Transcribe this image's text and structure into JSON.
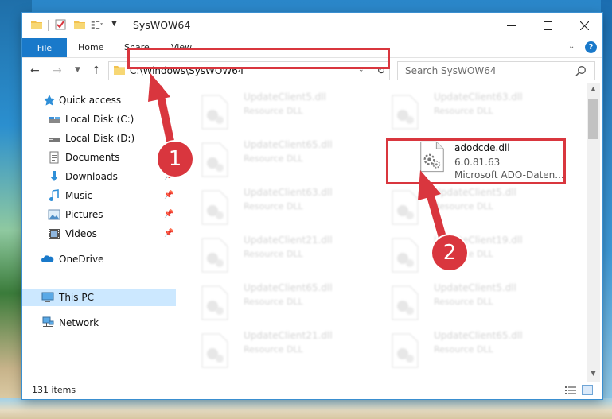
{
  "window": {
    "title": "SysWOW64"
  },
  "ribbon": {
    "file": "File",
    "home": "Home",
    "share": "Share",
    "view": "View",
    "help": "?"
  },
  "address": {
    "path": "C:\\Windows\\SysWOW64"
  },
  "search": {
    "placeholder": "Search SysWOW64"
  },
  "nav_pane": {
    "quick_access": "Quick access",
    "items": [
      {
        "label": "Local Disk (C:)",
        "icon": "drive-icon",
        "pinned": false
      },
      {
        "label": "Local Disk (D:)",
        "icon": "drive-icon",
        "pinned": false
      },
      {
        "label": "Documents",
        "icon": "documents-icon",
        "pinned": false
      },
      {
        "label": "Downloads",
        "icon": "downloads-icon",
        "pinned": true
      },
      {
        "label": "Music",
        "icon": "music-icon",
        "pinned": true
      },
      {
        "label": "Pictures",
        "icon": "pictures-icon",
        "pinned": true
      },
      {
        "label": "Videos",
        "icon": "videos-icon",
        "pinned": true
      }
    ],
    "onedrive": "OneDrive",
    "this_pc": "This PC",
    "network": "Network"
  },
  "files": [
    {
      "name": "UpdateClient5.dll",
      "type": "Resource DLL"
    },
    {
      "name": "UpdateClient63.dll",
      "type": "Resource DLL"
    },
    {
      "name": "UpdateClient65.dll",
      "type": "Resource DLL"
    },
    {
      "name": "UpdateClient63.dll",
      "type": "Resource DLL"
    },
    {
      "name": "UpdateClient5.dll",
      "type": "Resource DLL"
    },
    {
      "name": "UpdateClient21.dll",
      "type": "Resource DLL"
    },
    {
      "name": "UpdateClient19.dll",
      "type": "Resource DLL"
    },
    {
      "name": "UpdateClient65.dll",
      "type": "Resource DLL"
    },
    {
      "name": "UpdateClient5.dll",
      "type": "Resource DLL"
    },
    {
      "name": "UpdateClient21.dll",
      "type": "Resource DLL"
    },
    {
      "name": "UpdateClient65.dll",
      "type": "Resource DLL"
    }
  ],
  "highlighted_file": {
    "name": "adodcde.dll",
    "version": "6.0.81.63",
    "description": "Microsoft ADO-Daten..."
  },
  "status": {
    "items": "131 items"
  },
  "markers": {
    "one": "1",
    "two": "2"
  },
  "colors": {
    "accent": "#1979ca",
    "highlight": "#d9363e",
    "selected": "#cce8ff"
  }
}
